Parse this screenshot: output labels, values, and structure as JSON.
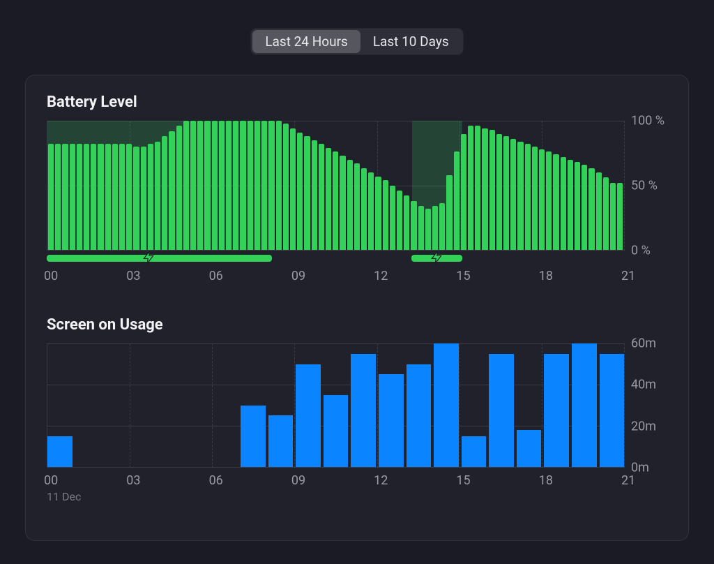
{
  "segmented": {
    "option_24h": "Last 24 Hours",
    "option_10d": "Last 10 Days"
  },
  "battery": {
    "title": "Battery Level",
    "y": {
      "t100": "100 %",
      "t50": "50 %",
      "t0": "0 %"
    }
  },
  "usage": {
    "title": "Screen on Usage",
    "y": {
      "t60": "60m",
      "t40": "40m",
      "t20": "20m",
      "t0": "0m"
    }
  },
  "xticks": {
    "t0": "00",
    "t3": "03",
    "t6": "06",
    "t9": "09",
    "t12": "12",
    "t15": "15",
    "t18": "18",
    "t21": "21"
  },
  "date_label": "11 Dec",
  "chart_data": [
    {
      "type": "bar",
      "title": "Battery Level",
      "xlabel": "",
      "ylabel": "%",
      "ylim": [
        0,
        100
      ],
      "x_start_hour": 0,
      "x_end_hour": 21,
      "x_tick_labels": [
        "00",
        "03",
        "06",
        "09",
        "12",
        "15",
        "18",
        "21"
      ],
      "tick_positions_pct": [
        0,
        14.2857,
        28.5714,
        42.8572,
        57.143,
        71.4286,
        85.7143,
        100
      ],
      "samples_per_hour": 4,
      "values": [
        82,
        82,
        82,
        82,
        82,
        82,
        82,
        82,
        82,
        82,
        82,
        82,
        80,
        80,
        82,
        84,
        88,
        92,
        96,
        100,
        100,
        100,
        100,
        100,
        100,
        100,
        100,
        100,
        100,
        100,
        100,
        100,
        100,
        98,
        94,
        91,
        88,
        85,
        82,
        79,
        76,
        73,
        70,
        67,
        63,
        60,
        57,
        54,
        50,
        46,
        42,
        38,
        34,
        32,
        34,
        36,
        58,
        76,
        90,
        96,
        96,
        94,
        93,
        90,
        88,
        86,
        84,
        82,
        80,
        78,
        76,
        74,
        72,
        70,
        68,
        66,
        63,
        60,
        56,
        52,
        52
      ],
      "charging_segments_pct": [
        {
          "start": 0.0,
          "end": 39.0
        },
        {
          "start": 63.2,
          "end": 72.0
        }
      ],
      "charge_bolt_positions_pct": [
        17.6,
        67.5
      ]
    },
    {
      "type": "bar",
      "title": "Screen on Usage",
      "xlabel": "",
      "ylabel": "minutes",
      "ylim": [
        0,
        60
      ],
      "categories": [
        "00",
        "01",
        "02",
        "03",
        "04",
        "05",
        "06",
        "07",
        "08",
        "09",
        "10",
        "11",
        "12",
        "13",
        "14",
        "15",
        "16",
        "17",
        "18",
        "19",
        "20"
      ],
      "x_tick_labels": [
        "00",
        "03",
        "06",
        "09",
        "12",
        "15",
        "18",
        "21"
      ],
      "tick_positions_pct": [
        0,
        14.2857,
        28.5714,
        42.8572,
        57.143,
        71.4286,
        85.7143,
        100
      ],
      "values": [
        15,
        0,
        0,
        0,
        0,
        0,
        0,
        30,
        25,
        50,
        35,
        55,
        45,
        50,
        60,
        15,
        55,
        18,
        55,
        60,
        55
      ]
    }
  ]
}
